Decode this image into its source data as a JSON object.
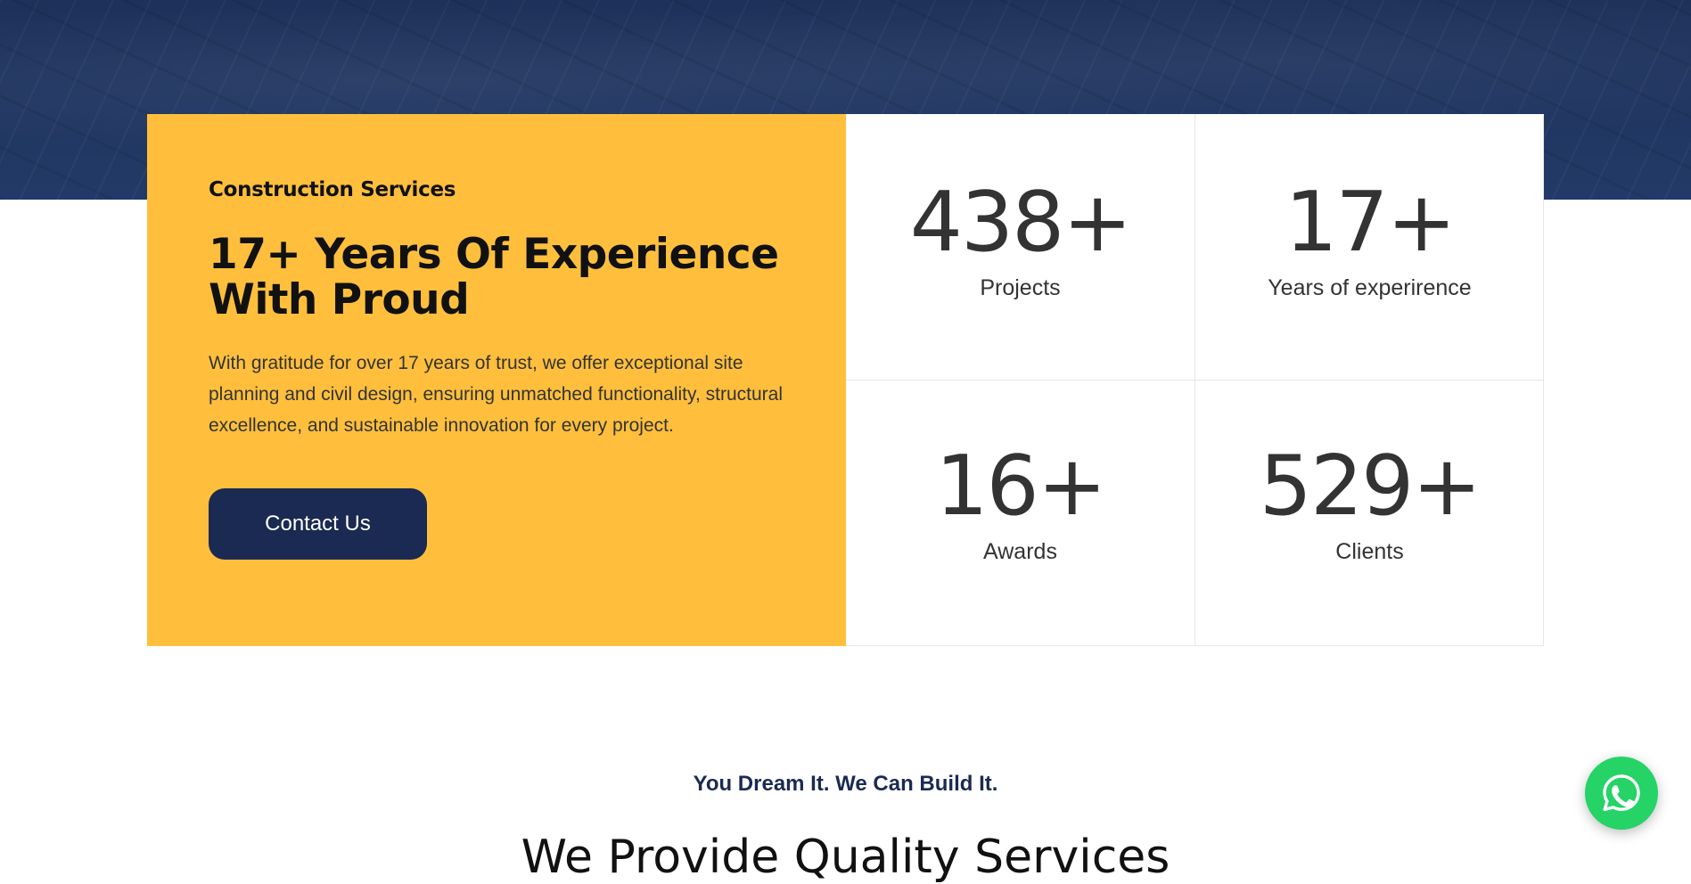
{
  "hero": {
    "eyebrow": "Construction Services",
    "headline": "17+ Years Of Experience With Proud",
    "description": "With gratitude for over 17 years of trust, we offer exceptional site planning and civil design, ensuring unmatched functionality, structural excellence, and sustainable innovation for every project.",
    "cta_label": "Contact Us"
  },
  "stats": [
    {
      "value": "438+",
      "label": "Projects"
    },
    {
      "value": "17+",
      "label": "Years of experirence"
    },
    {
      "value": "16+",
      "label": "Awards"
    },
    {
      "value": "529+",
      "label": "Clients"
    }
  ],
  "services": {
    "tagline": "You Dream It. We Can Build It.",
    "title": "We Provide Quality Services"
  },
  "icons": {
    "chat": "whatsapp-icon"
  },
  "colors": {
    "navy": "#1a2a52",
    "hero_band": "#1f3461",
    "accent_yellow": "#ffbf3c",
    "whatsapp_green": "#25d366"
  }
}
